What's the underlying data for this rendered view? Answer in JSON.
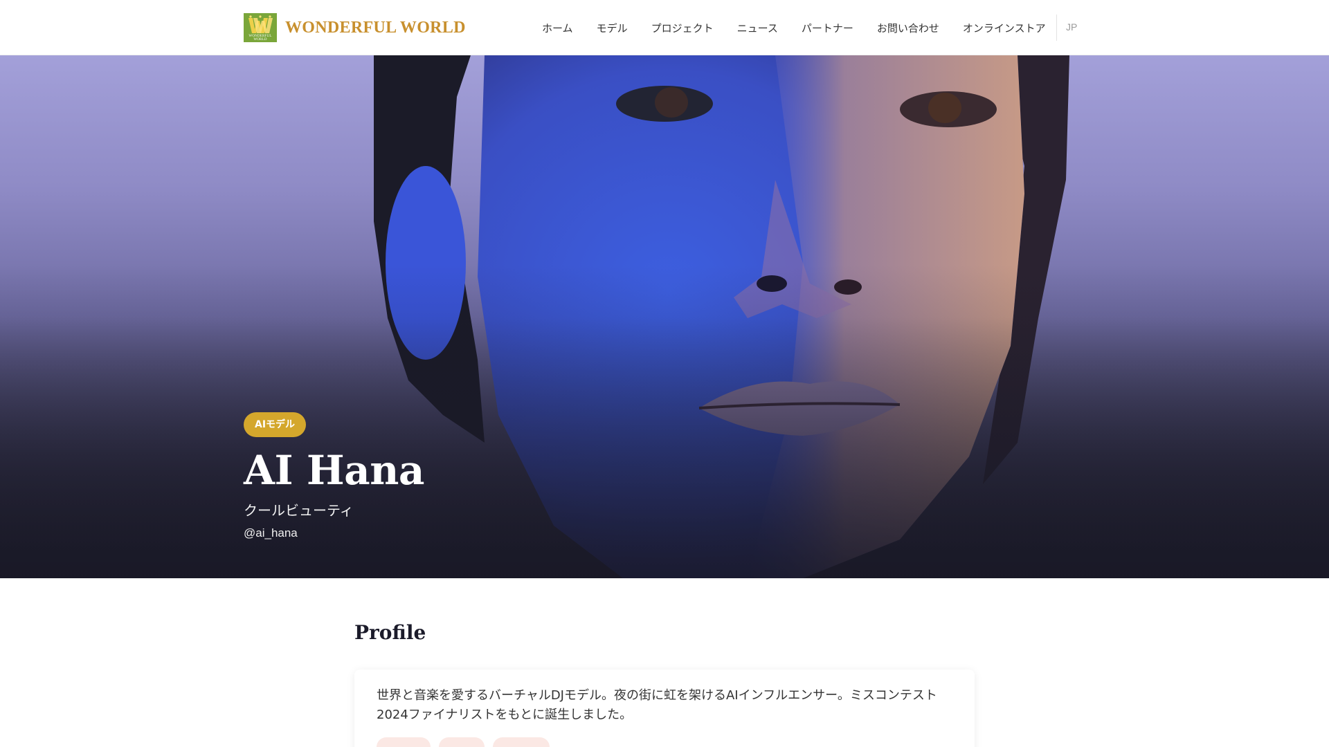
{
  "header": {
    "brand": "WONDERFUL WORLD",
    "logo_text": "WW",
    "logo_small_text": "WONDERFUL WORLD",
    "nav": [
      {
        "label": "ホーム"
      },
      {
        "label": "モデル"
      },
      {
        "label": "プロジェクト"
      },
      {
        "label": "ニュース"
      },
      {
        "label": "パートナー"
      },
      {
        "label": "お問い合わせ"
      },
      {
        "label": "オンラインストア"
      }
    ],
    "lang": "JP"
  },
  "hero": {
    "badge": "AIモデル",
    "name": "AI Hana",
    "subtitle": "クールビューティ",
    "handle": "@ai_hana"
  },
  "profile": {
    "title": "Profile",
    "text_line1": "世界と音楽を愛するバーチャルDJモデル。夜の街に虹を架けるAIインフルエンサー。ミスコンテスト",
    "text_line2": "2024ファイナリストをもとに誕生しました。"
  },
  "colors": {
    "brand_gold": "#c8902e",
    "logo_green": "#7aa63a",
    "badge_gold": "#d4a72c",
    "hero_top": "#a3a0d9",
    "hero_bottom": "#24232f"
  }
}
